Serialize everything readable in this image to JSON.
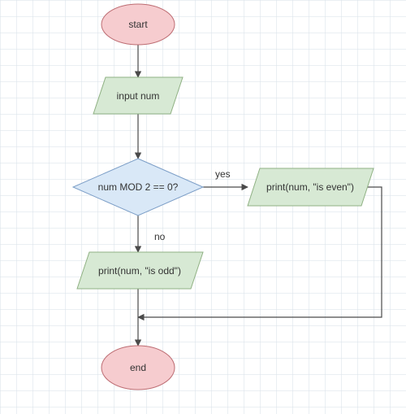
{
  "chart_data": {
    "type": "flowchart",
    "title": "",
    "nodes": [
      {
        "id": "start",
        "kind": "terminator",
        "label": "start"
      },
      {
        "id": "input",
        "kind": "io",
        "label": "input num"
      },
      {
        "id": "decision",
        "kind": "decision",
        "label": "num MOD 2 == 0?"
      },
      {
        "id": "even",
        "kind": "io",
        "label": "print(num, \"is even\")"
      },
      {
        "id": "odd",
        "kind": "io",
        "label": "print(num, \"is odd\")"
      },
      {
        "id": "end",
        "kind": "terminator",
        "label": "end"
      }
    ],
    "edges": [
      {
        "from": "start",
        "to": "input",
        "label": ""
      },
      {
        "from": "input",
        "to": "decision",
        "label": ""
      },
      {
        "from": "decision",
        "to": "even",
        "label": "yes"
      },
      {
        "from": "decision",
        "to": "odd",
        "label": "no"
      },
      {
        "from": "odd",
        "to": "end",
        "label": ""
      },
      {
        "from": "even",
        "to": "end",
        "label": ""
      }
    ]
  },
  "colors": {
    "terminator_fill": "#f6cccf",
    "terminator_stroke": "#bd6c72",
    "io_fill": "#d7e9d4",
    "io_stroke": "#8fb183",
    "decision_fill": "#d9e8f7",
    "decision_stroke": "#7c9ec7",
    "edge_stroke": "#4a4a4a",
    "grid": "#dce4eb"
  }
}
